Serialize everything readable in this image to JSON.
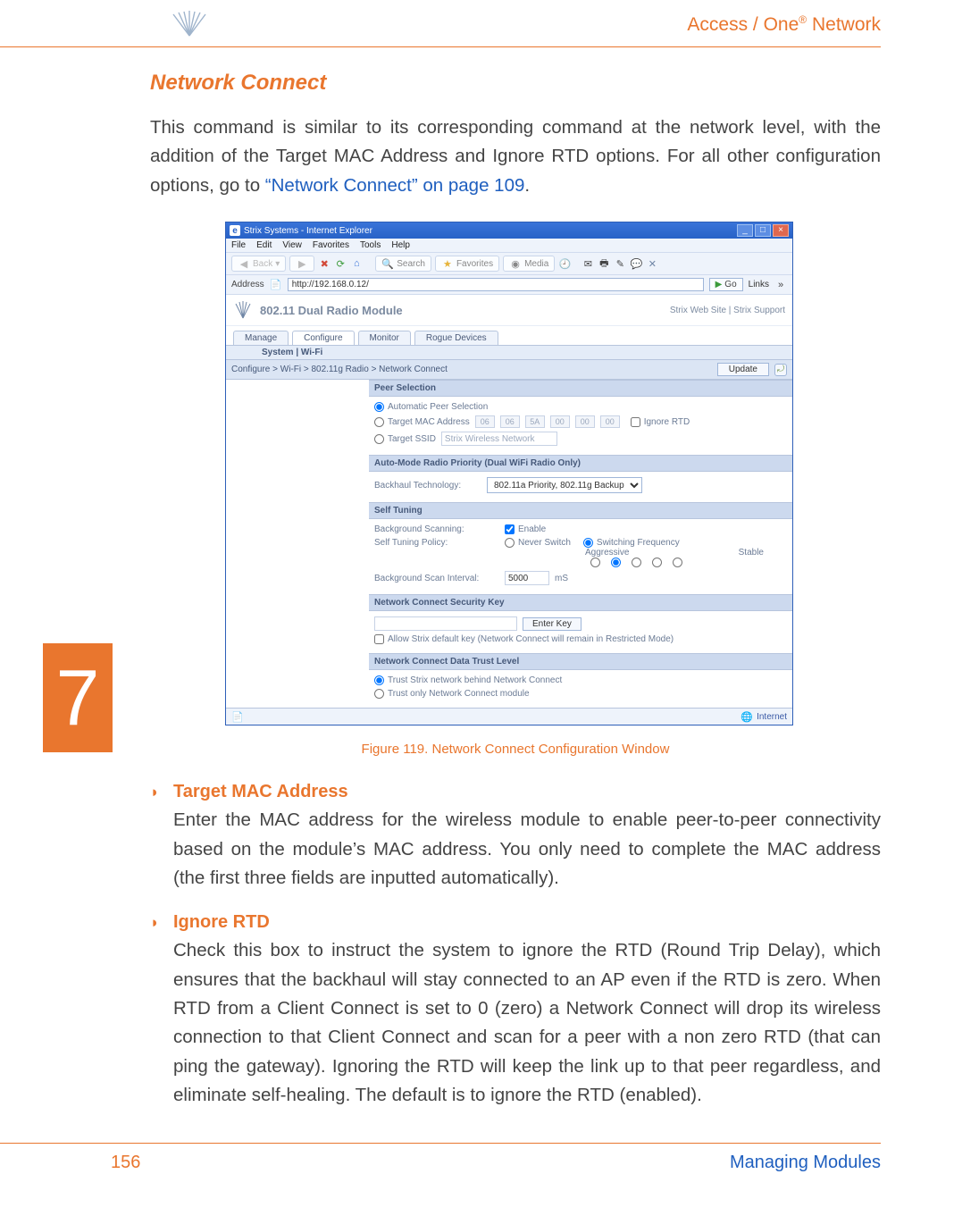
{
  "header": {
    "product_line_html": "Access / One<sup>®</sup> Network"
  },
  "chapter_tab": "7",
  "section": {
    "title": "Network Connect"
  },
  "intro": {
    "text_pre": "This command is similar to its corresponding command at the network level, with the addition of the Target MAC Address and Ignore RTD options. For all other configuration options, go to ",
    "xref": "“Network Connect” on page 109",
    "text_post": "."
  },
  "figure_caption": "Figure 119. Network Connect Configuration Window",
  "options": [
    {
      "title": "Target MAC Address",
      "body": "Enter the MAC address for the wireless module to enable peer-to-peer connectivity based on the module’s MAC address. You only need to complete the MAC address (the first three fields are inputted automatically)."
    },
    {
      "title": "Ignore RTD",
      "body": "Check this box to instruct the system to ignore the RTD (Round Trip Delay), which ensures that the backhaul will stay connected to an AP even if the RTD is zero. When RTD from a Client Connect is set to 0 (zero) a Network Connect will drop its wireless connection to that Client Connect and scan for a peer with a non zero RTD (that can ping the gateway). Ignoring the RTD will keep the link up to that peer regardless, and eliminate self-healing. The default is to ignore the RTD (enabled)."
    }
  ],
  "footer": {
    "page_number": "156",
    "section": "Managing Modules"
  },
  "screenshot": {
    "window_title": "Strix Systems - Internet Explorer",
    "menubar": [
      "File",
      "Edit",
      "View",
      "Favorites",
      "Tools",
      "Help"
    ],
    "toolbar": {
      "back": "Back",
      "search": "Search",
      "favorites": "Favorites",
      "media": "Media"
    },
    "address": {
      "label": "Address",
      "url": "http://192.168.0.12/",
      "go": "Go",
      "links": "Links"
    },
    "app_header": {
      "module_title": "802.11 Dual Radio Module",
      "right": "Strix Web Site  |  Strix Support"
    },
    "tabs": [
      "Manage",
      "Configure",
      "Monitor",
      "Rogue Devices"
    ],
    "active_tab": 1,
    "subtabs": "System  |  Wi-Fi",
    "breadcrumb": "Configure > Wi-Fi > 802.11g Radio > Network Connect",
    "update_btn": "Update",
    "groups": {
      "peer_selection": {
        "title": "Peer Selection",
        "auto_label": "Automatic Peer Selection",
        "target_mac_label": "Target MAC Address",
        "mac": [
          "06",
          "06",
          "5A",
          "00",
          "00",
          "00"
        ],
        "ignore_rtd_label": "Ignore RTD",
        "target_ssid_label": "Target SSID",
        "target_ssid_value": "Strix Wireless Network"
      },
      "auto_mode": {
        "title": "Auto-Mode Radio Priority (Dual WiFi Radio Only)",
        "backhaul_label": "Backhaul Technology:",
        "backhaul_value": "802.11a Priority, 802.11g Backup"
      },
      "self_tuning": {
        "title": "Self Tuning",
        "bg_scan_label": "Background Scanning:",
        "enable_label": "Enable",
        "policy_label": "Self Tuning Policy:",
        "never_switch": "Never Switch",
        "switch_freq": "Switching Frequency",
        "aggr": "Aggressive",
        "stable": "Stable",
        "scan_interval_label": "Background Scan Interval:",
        "scan_interval_value": "5000",
        "scan_interval_unit": "mS"
      },
      "sec_key": {
        "title": "Network Connect Security Key",
        "enter_key_btn": "Enter Key",
        "allow_default": "Allow Strix default key (Network Connect will remain in Restricted Mode)"
      },
      "trust": {
        "title": "Network Connect Data Trust Level",
        "trust_network": "Trust Strix network behind Network Connect",
        "trust_only_module": "Trust only Network Connect module"
      }
    },
    "statusbar_right": "Internet"
  }
}
